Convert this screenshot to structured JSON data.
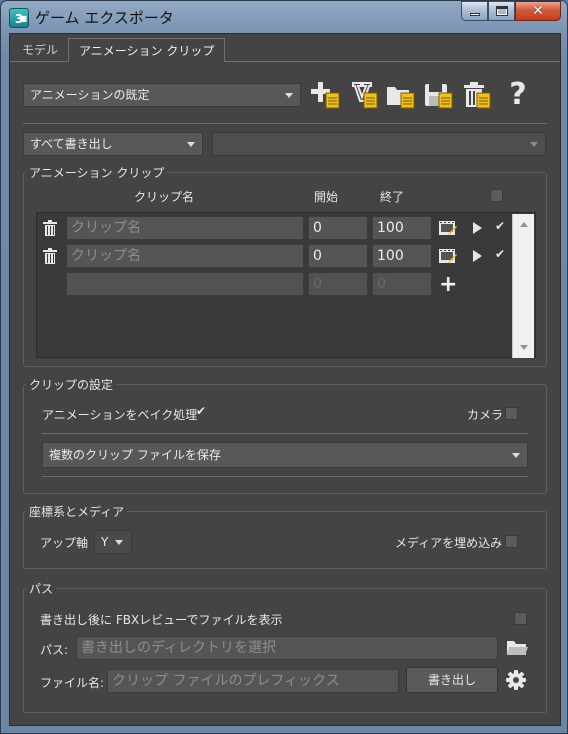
{
  "window": {
    "title": "ゲーム エクスポータ",
    "icon_text": "3"
  },
  "tabs": [
    {
      "label": "モデル"
    },
    {
      "label": "アニメーション クリップ"
    }
  ],
  "preset": {
    "selected": "アニメーションの既定"
  },
  "toolbar": {
    "icons": [
      "add-preset-icon",
      "edit-preset-icon",
      "load-preset-icon",
      "save-preset-icon",
      "delete-preset-icon",
      "help-icon"
    ],
    "help_glyph": "?"
  },
  "export_mode": {
    "selected": "すべて書き出し",
    "secondary": ""
  },
  "anim_clips": {
    "group_label": "アニメーション クリップ",
    "headers": {
      "name": "クリップ名",
      "start": "開始",
      "end": "終了"
    },
    "rows": [
      {
        "name_placeholder": "クリップ名",
        "start": "0",
        "end": "100",
        "checked": true
      },
      {
        "name_placeholder": "クリップ名",
        "start": "0",
        "end": "100",
        "checked": true
      }
    ],
    "new_row": {
      "start": "0",
      "end": "0"
    }
  },
  "clip_settings": {
    "group_label": "クリップの設定",
    "bake_label": "アニメーションをベイク処理",
    "camera_label": "カメラ",
    "save_mode": "複数のクリップ ファイルを保存"
  },
  "coords": {
    "group_label": "座標系とメディア",
    "up_axis_label": "アップ軸",
    "up_axis_value": "Y",
    "embed_media_label": "メディアを埋め込み"
  },
  "path": {
    "group_label": "パス",
    "view_after_label": "書き出し後に FBXレビューでファイルを表示",
    "path_label": "パス:",
    "path_placeholder": "書き出しのディレクトリを選択",
    "filename_label": "ファイル名:",
    "filename_placeholder": "クリップ ファイルのプレフィックス",
    "export_button": "書き出し"
  },
  "colors": {
    "panel": "#444444",
    "field": "#555555",
    "accent_yellow": "#f0c020",
    "titlebar": "#7b94b3"
  }
}
